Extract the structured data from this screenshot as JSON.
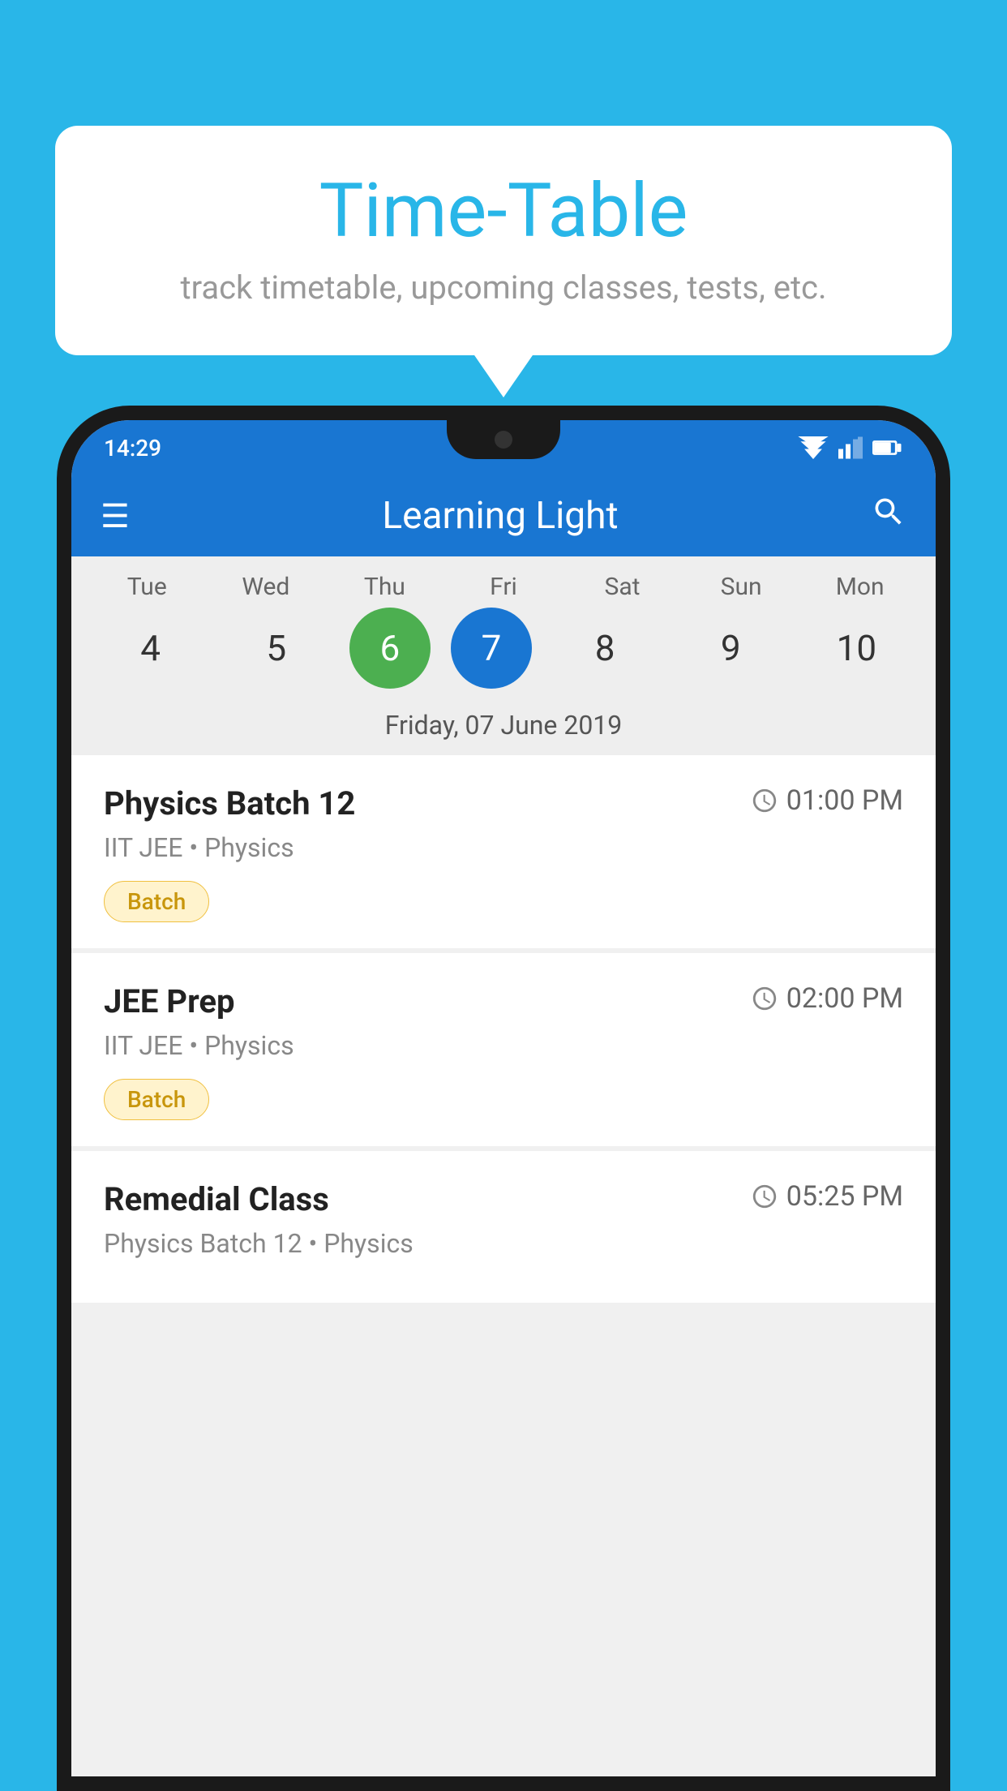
{
  "page": {
    "background_color": "#29B6E8"
  },
  "speech_bubble": {
    "title": "Time-Table",
    "subtitle": "track timetable, upcoming classes, tests, etc."
  },
  "status_bar": {
    "time": "14:29"
  },
  "app_bar": {
    "title": "Learning Light",
    "menu_icon": "☰",
    "search_icon": "🔍"
  },
  "calendar": {
    "days": [
      {
        "label": "Tue",
        "number": "4"
      },
      {
        "label": "Wed",
        "number": "5"
      },
      {
        "label": "Thu",
        "number": "6",
        "state": "today"
      },
      {
        "label": "Fri",
        "number": "7",
        "state": "selected"
      },
      {
        "label": "Sat",
        "number": "8"
      },
      {
        "label": "Sun",
        "number": "9"
      },
      {
        "label": "Mon",
        "number": "10"
      }
    ],
    "selected_date_label": "Friday, 07 June 2019"
  },
  "classes": [
    {
      "name": "Physics Batch 12",
      "time": "01:00 PM",
      "subject": "IIT JEE • Physics",
      "badge": "Batch"
    },
    {
      "name": "JEE Prep",
      "time": "02:00 PM",
      "subject": "IIT JEE • Physics",
      "badge": "Batch"
    },
    {
      "name": "Remedial Class",
      "time": "05:25 PM",
      "subject": "Physics Batch 12 • Physics",
      "badge": ""
    }
  ]
}
